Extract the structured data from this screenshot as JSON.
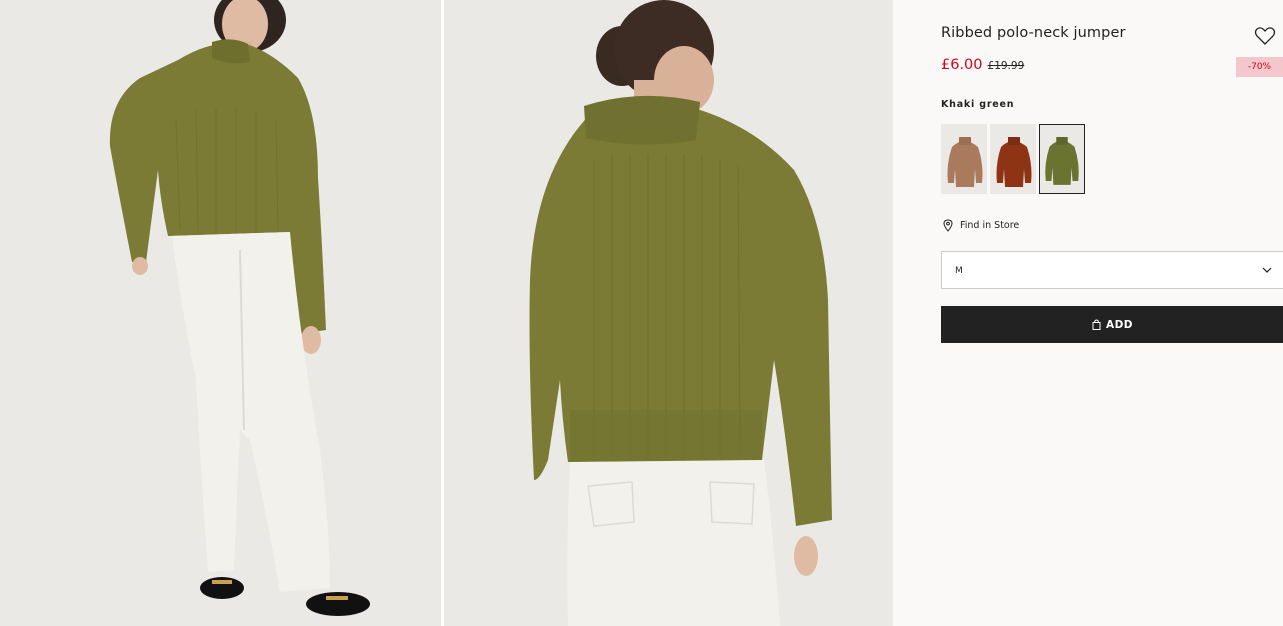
{
  "product": {
    "title": "Ribbed polo-neck jumper",
    "price_sale": "£6.00",
    "price_original": "£19.99",
    "discount_badge": "-70%",
    "color_name": "Khaki green"
  },
  "swatches": [
    {
      "name": "Beige",
      "color": "#a97a5c"
    },
    {
      "name": "Rust",
      "color": "#8e3414"
    },
    {
      "name": "Khaki green",
      "color": "#6b7330",
      "selected": true
    }
  ],
  "actions": {
    "find_in_store": "Find in Store",
    "size_value": "M",
    "add_label": "ADD"
  },
  "colors": {
    "sale_red": "#d6001c",
    "badge_bg": "#f4c7cc",
    "button_bg": "#222222",
    "sweater": "#7b7b35",
    "jeans": "#f2f1ec"
  },
  "icons": {
    "favorite": "heart-icon",
    "store": "location-pin-icon",
    "dropdown": "chevron-down-icon",
    "bag": "shopping-bag-icon"
  }
}
